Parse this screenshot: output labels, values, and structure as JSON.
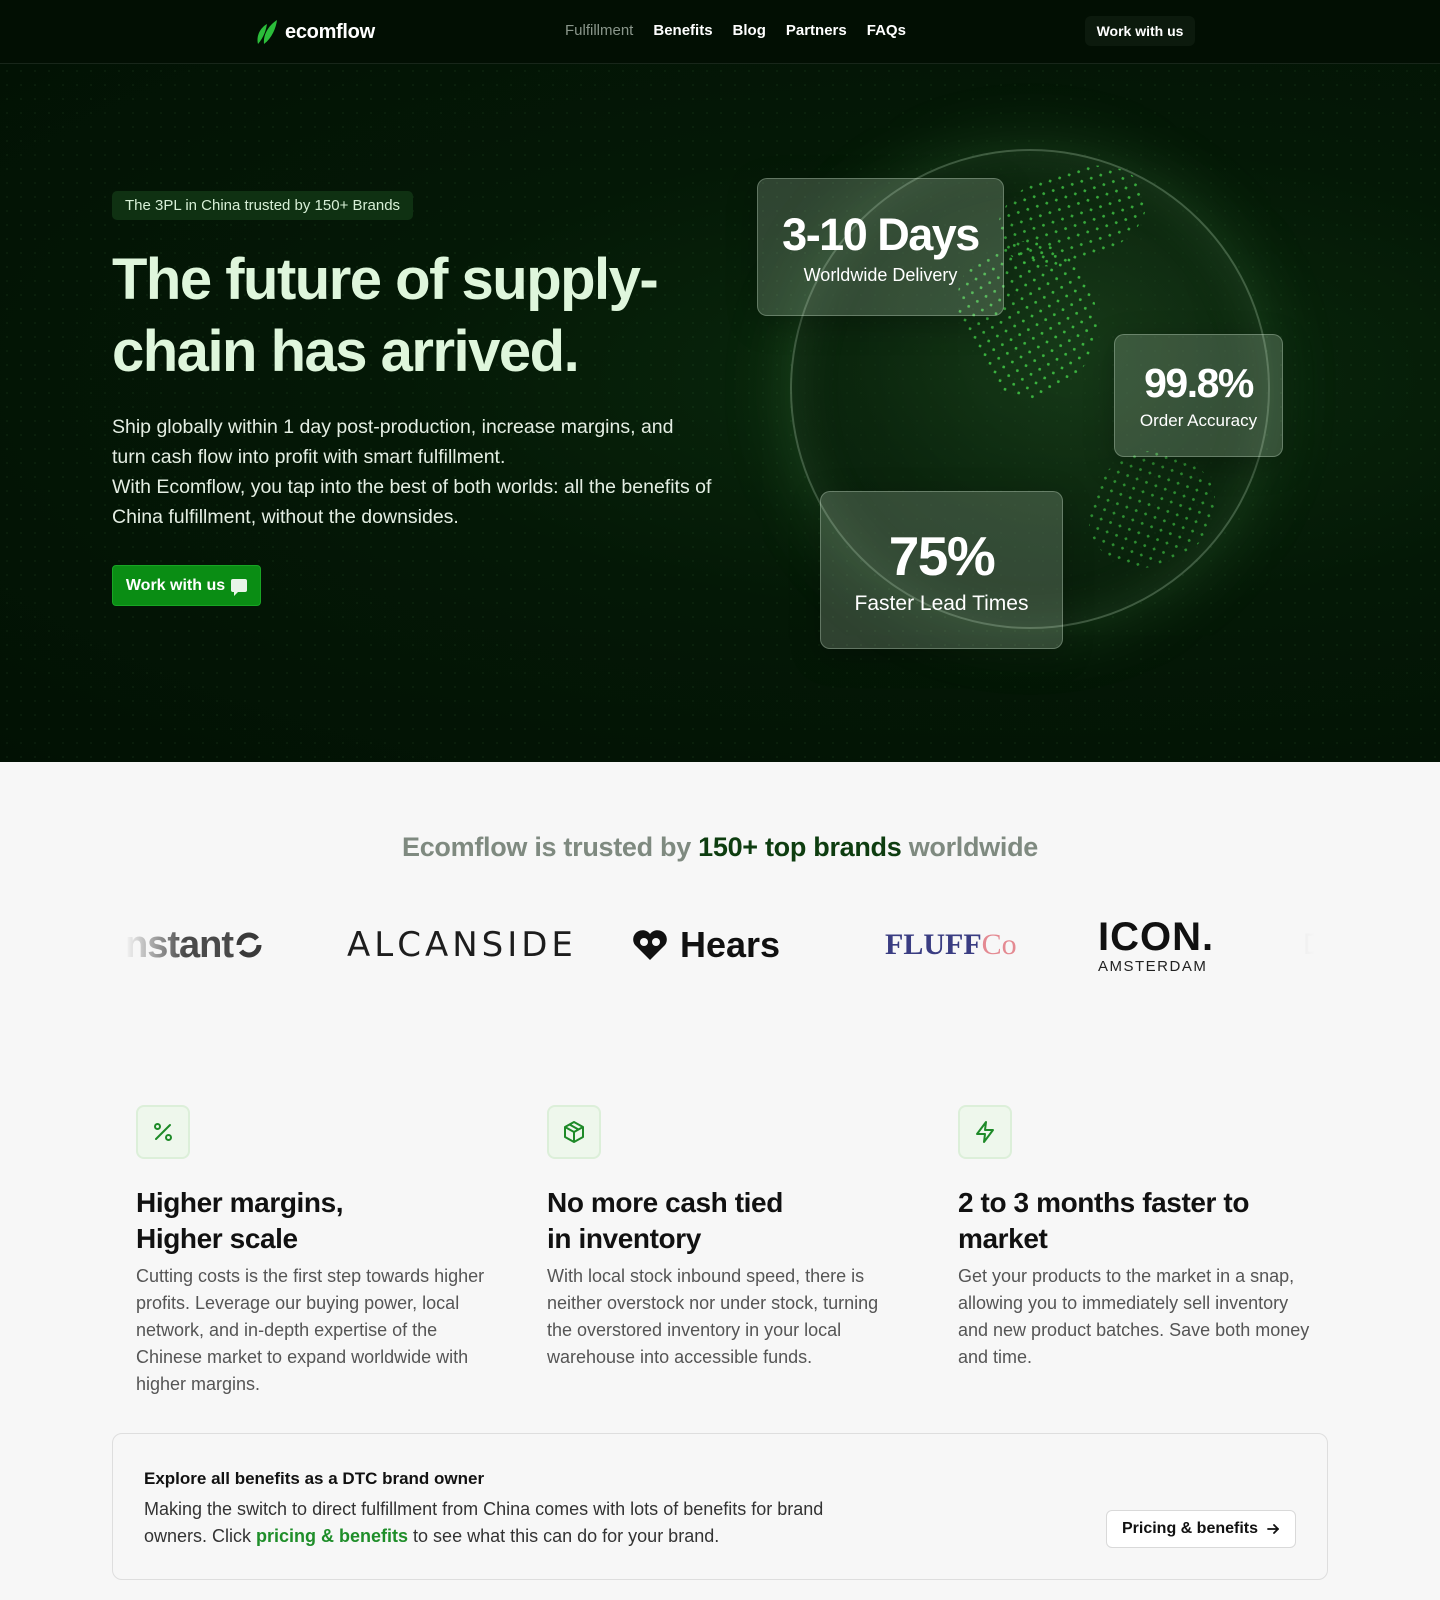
{
  "nav": {
    "logo_text": "ecomflow",
    "links": [
      "Fulfillment",
      "Benefits",
      "Blog",
      "Partners",
      "FAQs"
    ],
    "cta": "Work with us"
  },
  "hero": {
    "badge": "The 3PL in China trusted by 150+ Brands",
    "title": "The future of supply-chain has arrived.",
    "description_1": "Ship globally within 1 day post-production, increase margins, and turn cash flow into profit with smart fulfillment.",
    "description_2": "With Ecomflow, you tap into the best of both worlds: all the benefits of China fulfillment, without the downsides.",
    "button": "Work with us",
    "stats": [
      {
        "value": "3-10 Days",
        "label": "Worldwide Delivery"
      },
      {
        "value": "99.8%",
        "label": "Order Accuracy"
      },
      {
        "value": "75%",
        "label": "Faster Lead Times"
      }
    ]
  },
  "trusted": {
    "prefix": "Ecomflow is trusted by",
    "highlight": "150+ top brands",
    "suffix": "worldwide",
    "brands": {
      "instant": "nstant",
      "alcanside": "ALCANSIDE",
      "hears": "Hears",
      "fluff": "FLUFF",
      "fluff_co": "Co",
      "icon": "ICON.",
      "icon_sub": "AMSTERDAM",
      "partial": "D"
    }
  },
  "features": [
    {
      "icon": "percent-icon",
      "title": "Higher margins,\nHigher scale",
      "text": "Cutting costs is the first step towards higher profits. Leverage our buying power, local network, and in-depth expertise of the Chinese market to expand worldwide with higher margins."
    },
    {
      "icon": "box-icon",
      "title": "No more cash tied\nin inventory",
      "text": "With local stock inbound speed, there is neither overstock nor under stock, turning the overstored inventory in your local warehouse into accessible funds."
    },
    {
      "icon": "lightning-icon",
      "title": "2 to 3 months faster to\nmarket",
      "text": "Get your products to the market in a snap, allowing you to immediately sell inventory and new product batches. Save both money and time."
    }
  ],
  "benefits_card": {
    "title": "Explore all benefits as a DTC brand owner",
    "text_before": "Making the switch to direct fulfillment from China comes with lots of benefits for brand owners. Click ",
    "link": "pricing & benefits",
    "text_after": " to see what this can do for your brand.",
    "button": "Pricing & benefits"
  },
  "colors": {
    "brand_green": "#0a8d14",
    "hero_bg": "#021104",
    "link_green": "#1f8e2a"
  }
}
